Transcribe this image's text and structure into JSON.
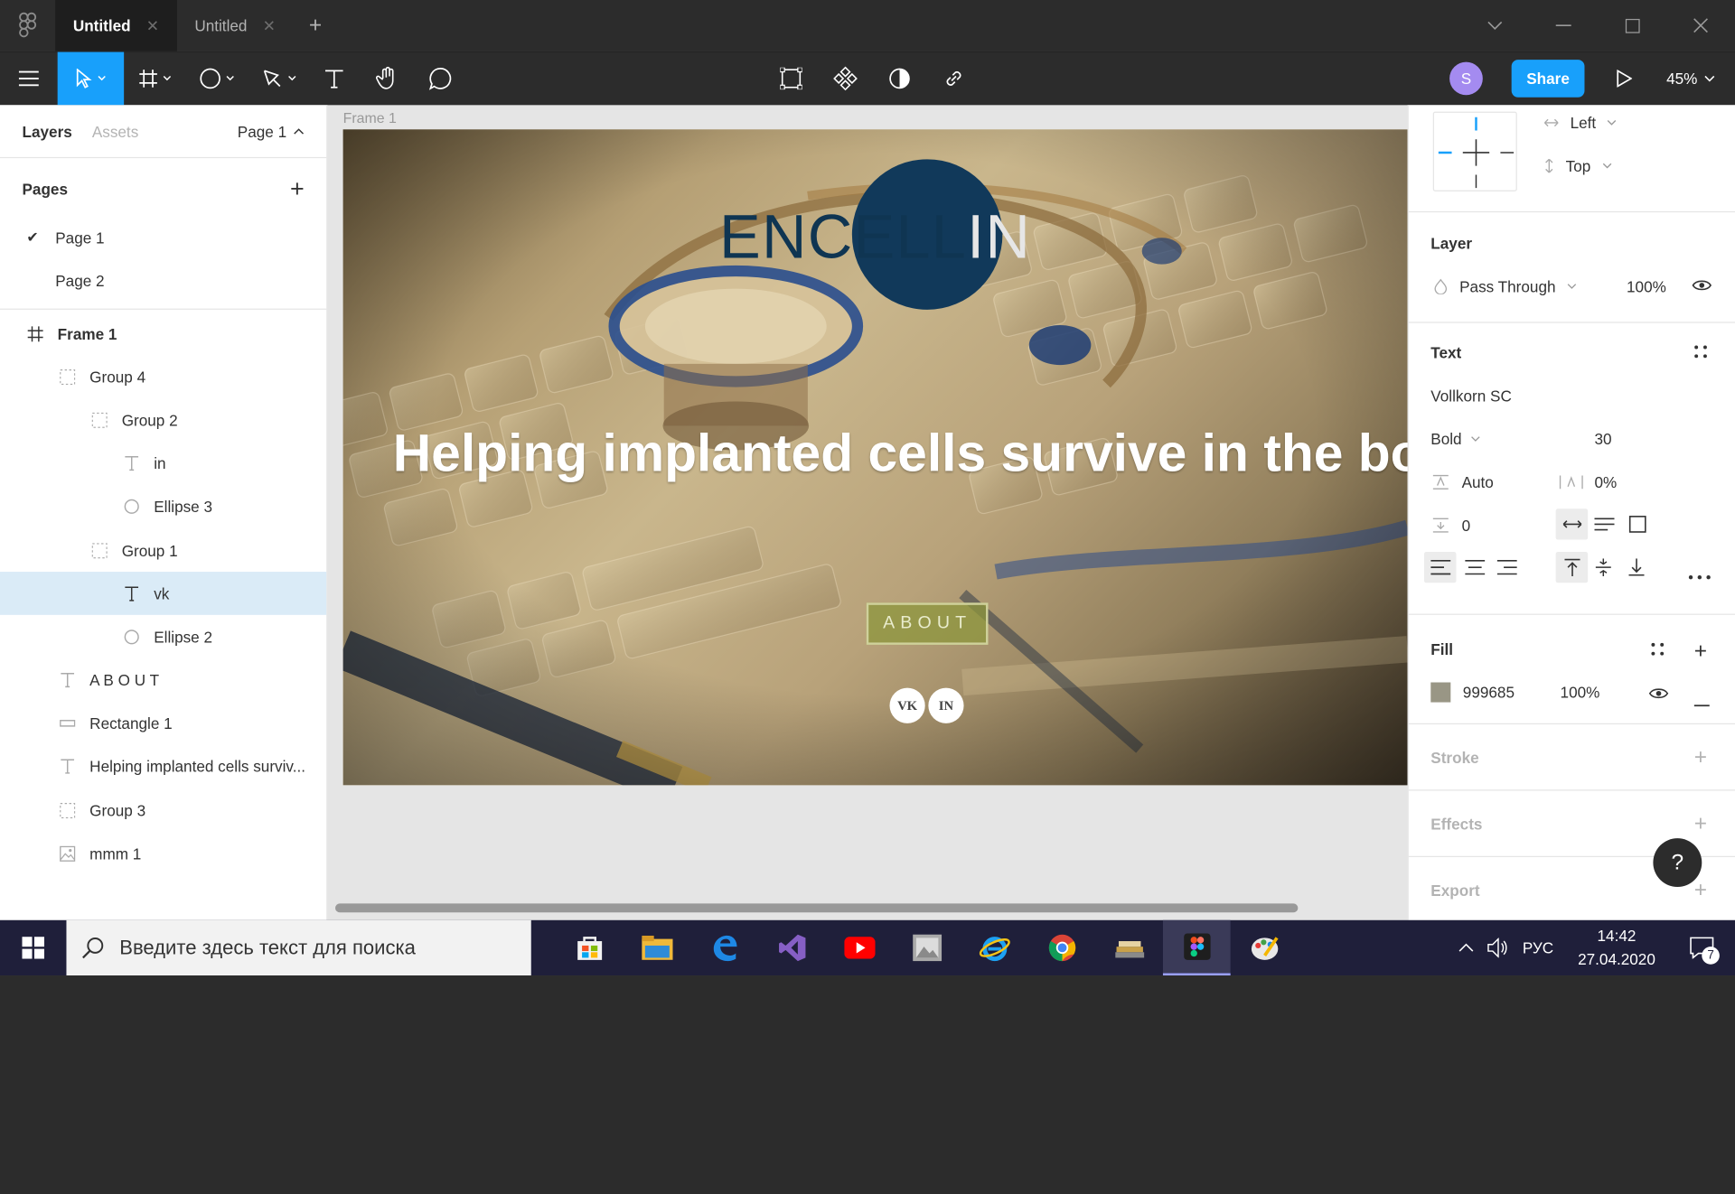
{
  "tabs": [
    {
      "label": "Untitled",
      "active": true
    },
    {
      "label": "Untitled",
      "active": false
    }
  ],
  "toolbar": {
    "avatar_initial": "S",
    "share_label": "Share",
    "zoom": "45%"
  },
  "left_panel": {
    "tab_layers": "Layers",
    "tab_assets": "Assets",
    "current_page": "Page 1",
    "pages_title": "Pages",
    "pages": [
      {
        "label": "Page 1",
        "checked": true
      },
      {
        "label": "Page 2",
        "checked": false
      }
    ],
    "layers": [
      {
        "label": "Frame 1",
        "icon": "frame-icon"
      },
      {
        "label": "Group 4",
        "icon": "group-icon"
      },
      {
        "label": "Group 2",
        "icon": "group-icon"
      },
      {
        "label": "in",
        "icon": "text-icon"
      },
      {
        "label": "Ellipse 3",
        "icon": "ellipse-icon"
      },
      {
        "label": "Group 1",
        "icon": "group-icon"
      },
      {
        "label": "vk",
        "icon": "text-icon",
        "selected": true
      },
      {
        "label": "Ellipse 2",
        "icon": "ellipse-icon"
      },
      {
        "label": "A B O U T",
        "icon": "text-icon"
      },
      {
        "label": "Rectangle 1",
        "icon": "rectangle-icon"
      },
      {
        "label": "Helping implanted cells surviv...",
        "icon": "text-icon"
      },
      {
        "label": "Group 3",
        "icon": "group-icon"
      },
      {
        "label": "mmm 1",
        "icon": "image-icon"
      }
    ]
  },
  "canvas": {
    "frame_label": "Frame 1",
    "logo_main": "ENCELL",
    "logo_in": "IN",
    "headline": "Helping implanted cells survive in the body",
    "about_label": "ABOUT",
    "social": [
      "VK",
      "IN"
    ]
  },
  "right_panel": {
    "constraint_h": "Left",
    "constraint_v": "Top",
    "layer_title": "Layer",
    "blend_mode": "Pass Through",
    "layer_opacity": "100%",
    "text_title": "Text",
    "font_family": "Vollkorn SC",
    "font_weight": "Bold",
    "font_size": "30",
    "line_height": "Auto",
    "letter_spacing": "0%",
    "paragraph_spacing": "0",
    "fill_title": "Fill",
    "fill_hex": "999685",
    "fill_opacity": "100%",
    "fill_color": "#999685",
    "stroke_title": "Stroke",
    "effects_title": "Effects",
    "export_title": "Export"
  },
  "taskbar": {
    "search_placeholder": "Введите здесь текст для поиска",
    "lang": "РУС",
    "time": "14:42",
    "date": "27.04.2020",
    "notifications": "7"
  },
  "colors": {
    "accent": "#18a0fb",
    "selection": "#daebf7",
    "logo_circle": "#11395a"
  }
}
